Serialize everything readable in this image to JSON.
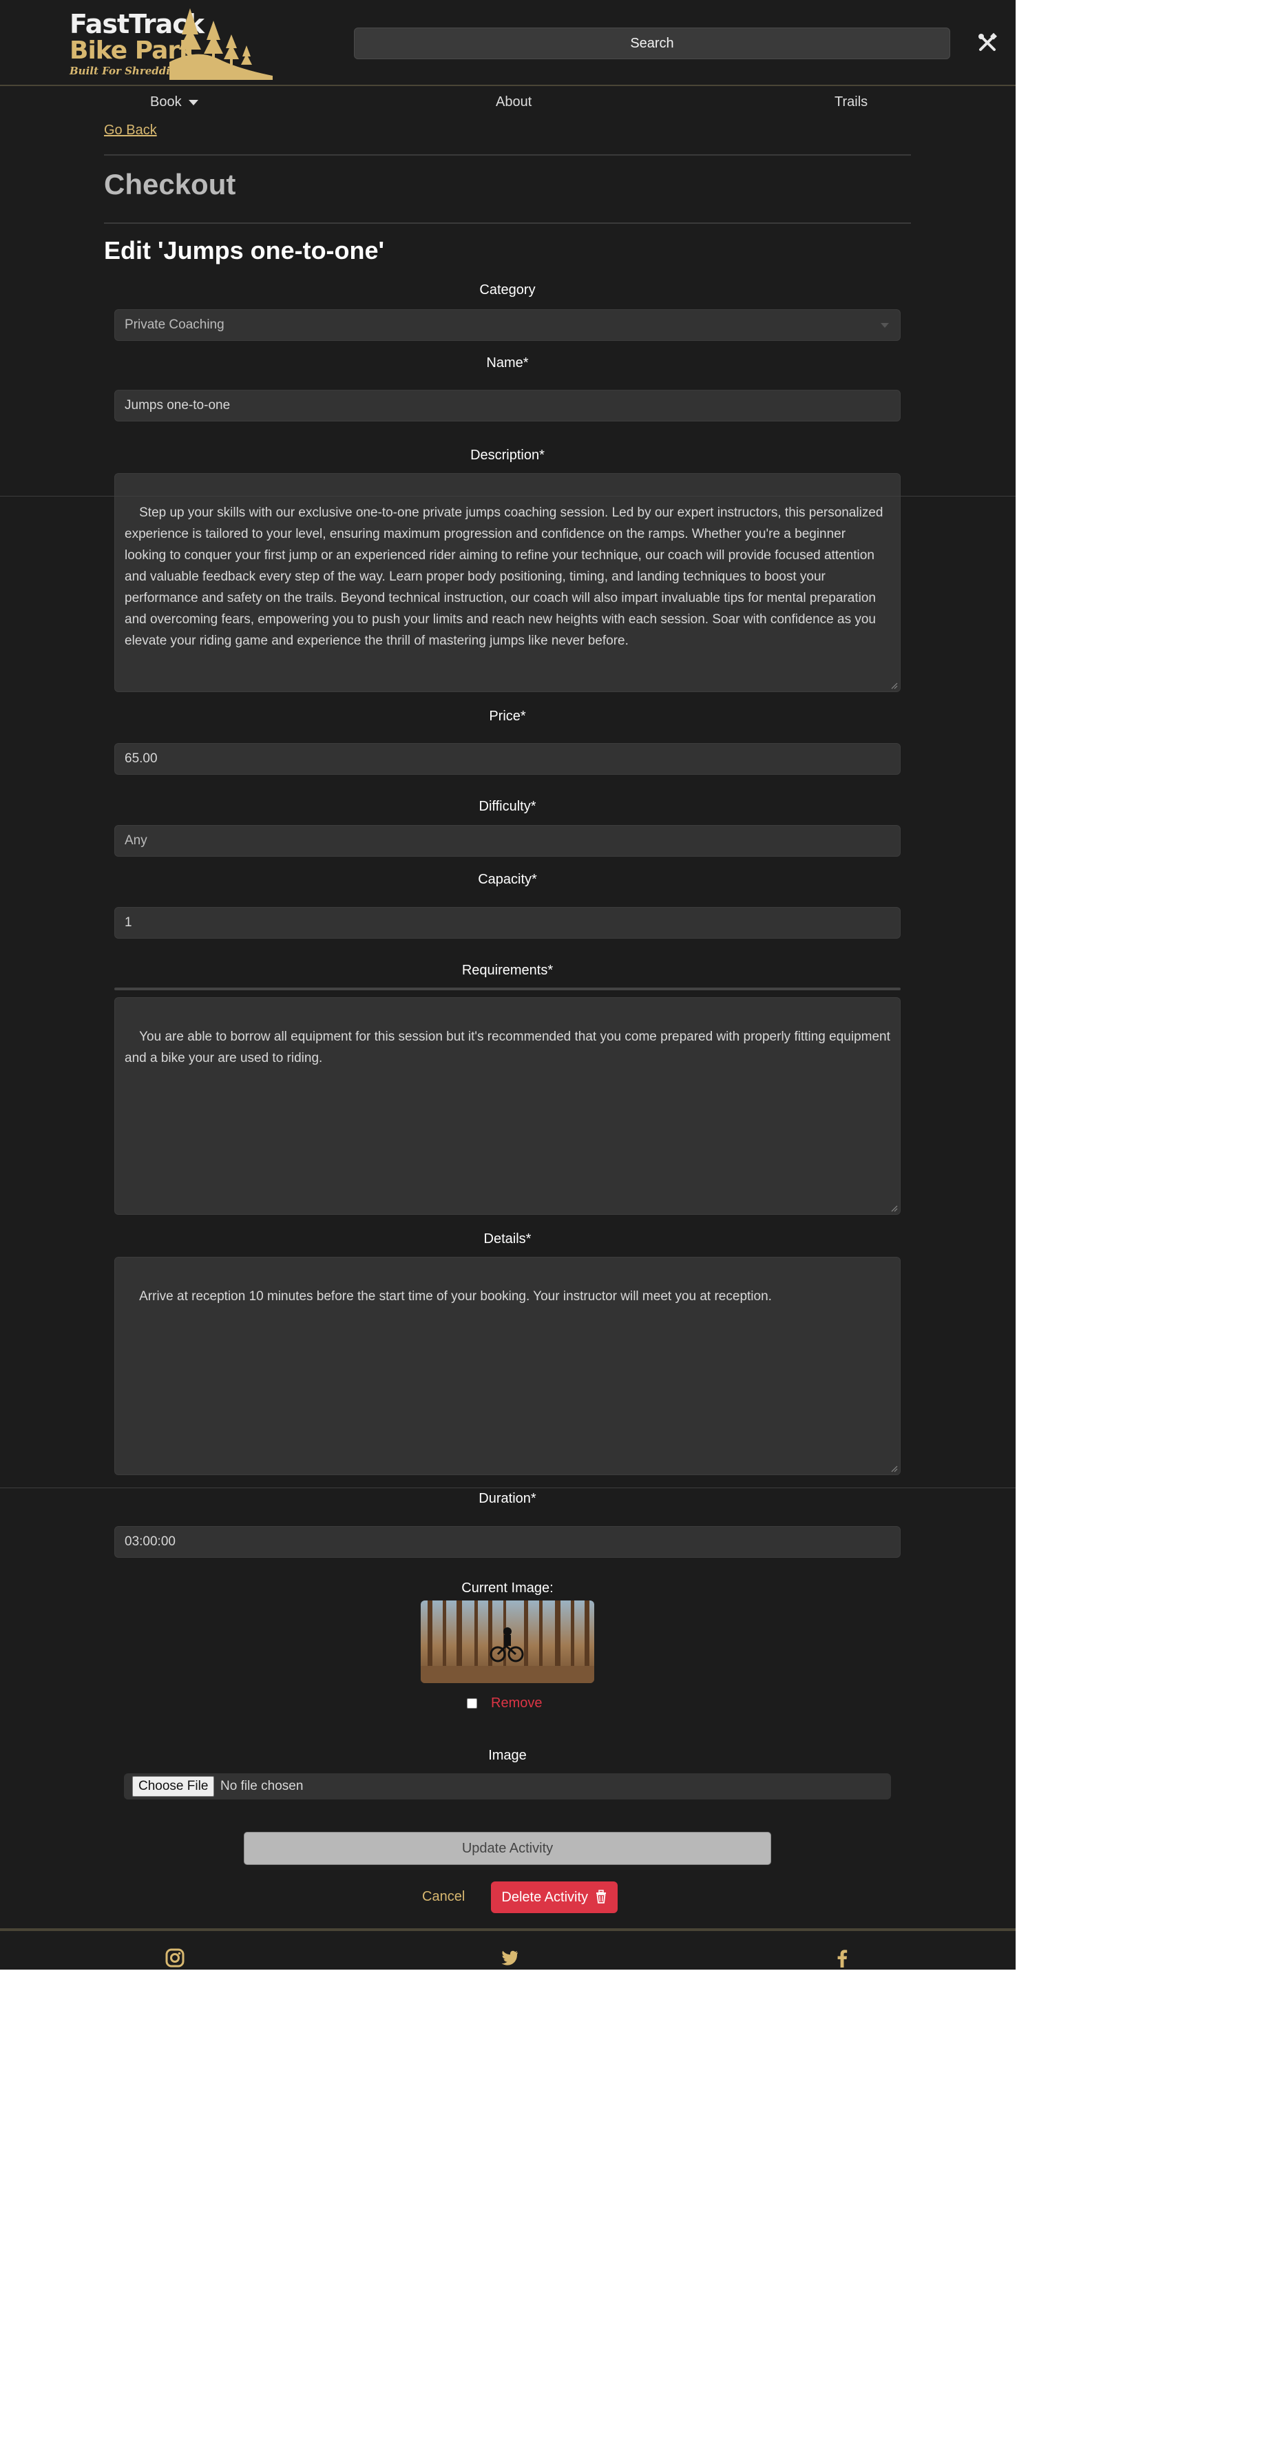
{
  "brand": {
    "logo_line1": "FastTrack",
    "logo_line2": "Bike Park",
    "tagline": "Built For Shredding",
    "accent_color": "#d8b870"
  },
  "header": {
    "search_label": "Search",
    "tools_icon": "tools-icon"
  },
  "nav": {
    "book": "Book",
    "about": "About",
    "trails": "Trails"
  },
  "go_back": "Go Back",
  "checkout_title": "Checkout",
  "edit_title": "Edit 'Jumps one-to-one'",
  "form": {
    "category": {
      "label": "Category",
      "value": "Private Coaching"
    },
    "name": {
      "label": "Name*",
      "value": "Jumps one-to-one"
    },
    "description": {
      "label": "Description*",
      "value": "Step up your skills with our exclusive one-to-one private jumps coaching session. Led by our expert instructors, this personalized experience is tailored to your level, ensuring maximum progression and confidence on the ramps. Whether you're a beginner looking to conquer your first jump or an experienced rider aiming to refine your technique, our coach will provide focused attention and valuable feedback every step of the way. Learn proper body positioning, timing, and landing techniques to boost your performance and safety on the trails. Beyond technical instruction, our coach will also impart invaluable tips for mental preparation and overcoming fears, empowering you to push your limits and reach new heights with each session. Soar with confidence as you elevate your riding game and experience the thrill of mastering jumps like never before."
    },
    "price": {
      "label": "Price*",
      "value": "65.00"
    },
    "difficulty": {
      "label": "Difficulty*",
      "value": "Any"
    },
    "capacity": {
      "label": "Capacity*",
      "value": "1"
    },
    "requirements": {
      "label": "Requirements*",
      "value": "You are able to borrow all equipment for this session but it's recommended that you come prepared with properly fitting equipment and a bike your are used to riding."
    },
    "details": {
      "label": "Details*",
      "value": "Arrive at reception 10 minutes before the start time of your booking. Your instructor will meet you at reception."
    },
    "duration": {
      "label": "Duration*",
      "value": "03:00:00"
    },
    "current_image_label": "Current Image:",
    "remove_label": "Remove",
    "image_label": "Image",
    "choose_file": "Choose File",
    "file_status": "No file chosen",
    "update_button": "Update Activity",
    "cancel": "Cancel",
    "delete_button": "Delete Activity"
  },
  "footer": {
    "icons": [
      "instagram-icon",
      "twitter-icon",
      "facebook-icon"
    ]
  }
}
